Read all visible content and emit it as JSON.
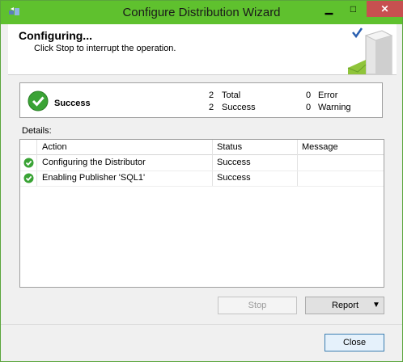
{
  "window": {
    "title": "Configure Distribution Wizard",
    "min_glyph": "▁",
    "max_glyph": "□",
    "close_glyph": "✕"
  },
  "header": {
    "title": "Configuring...",
    "subtitle": "Click Stop to interrupt the operation."
  },
  "summary": {
    "status": "Success",
    "total_count": "2",
    "total_label": "Total",
    "success_count": "2",
    "success_label": "Success",
    "error_count": "0",
    "error_label": "Error",
    "warning_count": "0",
    "warning_label": "Warning"
  },
  "details": {
    "label": "Details:",
    "columns": {
      "action": "Action",
      "status": "Status",
      "message": "Message"
    },
    "rows": [
      {
        "action": "Configuring the Distributor",
        "status": "Success",
        "message": ""
      },
      {
        "action": "Enabling Publisher 'SQL1'",
        "status": "Success",
        "message": ""
      }
    ]
  },
  "buttons": {
    "stop": "Stop",
    "report": "Report",
    "report_arrow": "▼",
    "close": "Close"
  },
  "colors": {
    "titlebar": "#5fc12e",
    "success_green": "#3aa335",
    "close_red": "#c75050"
  },
  "icons": {
    "app": "wizard-icon",
    "header": "server-check-icon",
    "status": "success-check-icon"
  }
}
